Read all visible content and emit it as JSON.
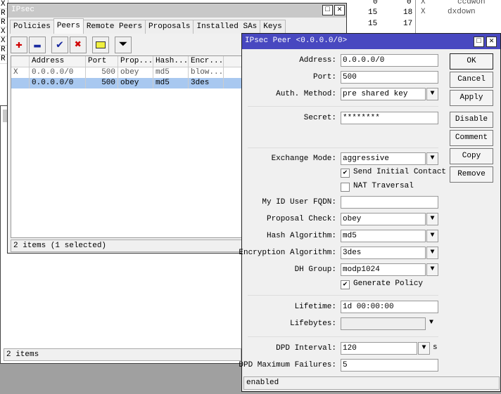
{
  "background": {
    "left_strip": [
      "X",
      "R",
      "R",
      "X",
      "X",
      "R",
      "R"
    ],
    "right_rows": [
      [
        "0",
        "0",
        "X",
        "ccdwon"
      ],
      [
        "15",
        "18",
        "X",
        "dxdown"
      ],
      [
        "15",
        "17",
        "",
        ""
      ]
    ],
    "status": "2 items"
  },
  "ipsec_window": {
    "title": "IPsec",
    "tabs": [
      "Policies",
      "Peers",
      "Remote Peers",
      "Proposals",
      "Installed SAs",
      "Keys"
    ],
    "active_tab": "Peers",
    "columns": [
      "",
      "Address",
      "Port",
      "Prop...",
      "Hash...",
      "Encr..."
    ],
    "rows": [
      {
        "flag": "X",
        "address": "0.0.0.0/0",
        "port": "500",
        "proposal": "obey",
        "hash": "md5",
        "enc": "blow...",
        "selected": false
      },
      {
        "flag": "",
        "address": "0.0.0.0/0",
        "port": "500",
        "proposal": "obey",
        "hash": "md5",
        "enc": "3des",
        "selected": true
      }
    ],
    "status": "2 items (1 selected)"
  },
  "peer_dialog": {
    "title": "IPsec Peer <0.0.0.0/0>",
    "fields": {
      "address": {
        "label": "Address:",
        "value": "0.0.0.0/0"
      },
      "port": {
        "label": "Port:",
        "value": "500"
      },
      "auth": {
        "label": "Auth. Method:",
        "value": "pre shared key"
      },
      "secret": {
        "label": "Secret:",
        "value": "********"
      },
      "exchange": {
        "label": "Exchange Mode:",
        "value": "aggressive"
      },
      "send_initial": {
        "label": "Send Initial Contact",
        "checked": true
      },
      "nat": {
        "label": "NAT Traversal",
        "checked": false
      },
      "fqdn": {
        "label": "My ID User FQDN:",
        "value": ""
      },
      "proposal": {
        "label": "Proposal Check:",
        "value": "obey"
      },
      "hash": {
        "label": "Hash Algorithm:",
        "value": "md5"
      },
      "enc": {
        "label": "Encryption Algorithm:",
        "value": "3des"
      },
      "dh": {
        "label": "DH Group:",
        "value": "modp1024"
      },
      "genpolicy": {
        "label": "Generate Policy",
        "checked": true
      },
      "lifetime": {
        "label": "Lifetime:",
        "value": "1d 00:00:00"
      },
      "lifebytes": {
        "label": "Lifebytes:",
        "value": ""
      },
      "dpd_interval": {
        "label": "DPD Interval:",
        "value": "120",
        "unit": "s"
      },
      "dpd_max": {
        "label": "DPD Maximum Failures:",
        "value": "5"
      }
    },
    "buttons": [
      "OK",
      "Cancel",
      "Apply",
      "Disable",
      "Comment",
      "Copy",
      "Remove"
    ],
    "status": "enabled"
  }
}
